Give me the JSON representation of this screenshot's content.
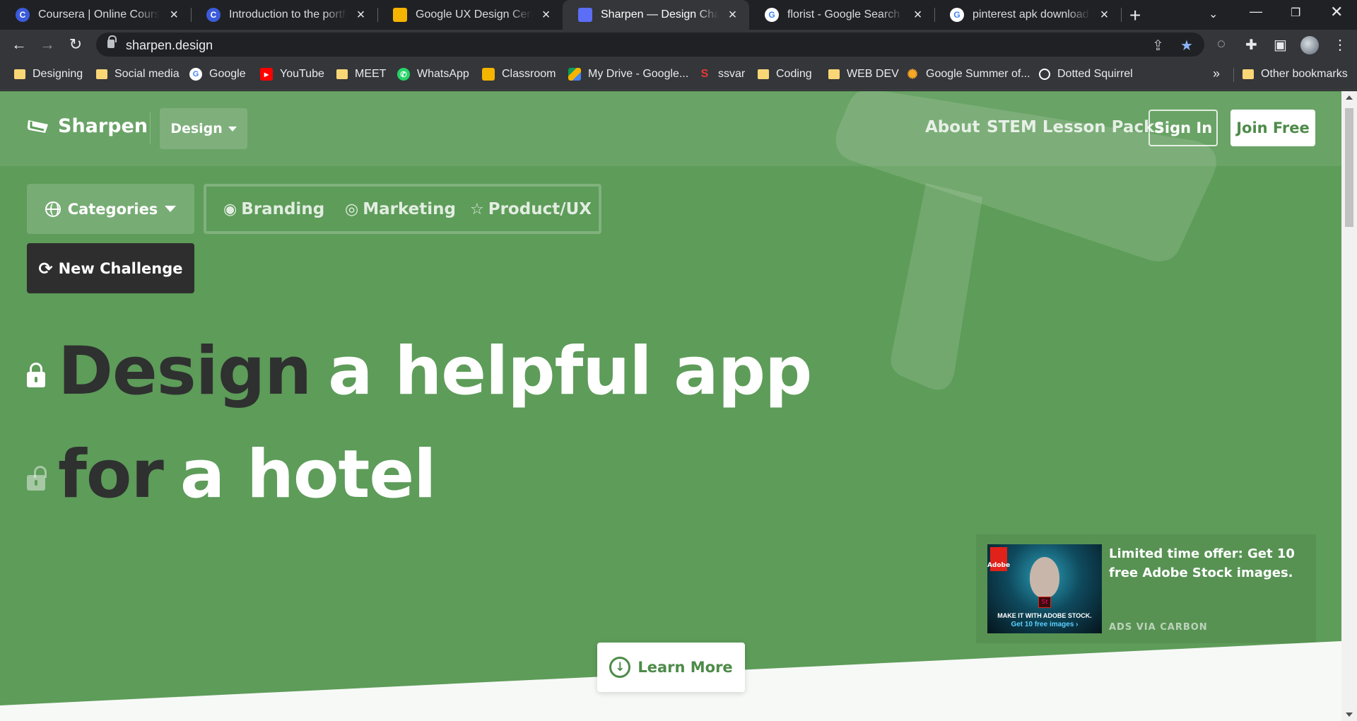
{
  "browser": {
    "tabs": [
      {
        "title": "Coursera | Online Courses & Credentials From Top Educators",
        "favicon": "coursera-icon",
        "favicon_color": "#3b5bdb"
      },
      {
        "title": "Introduction to the portfolio",
        "favicon": "coursera-icon",
        "favicon_color": "#3b5bdb"
      },
      {
        "title": "Google UX Design Certificate",
        "favicon": "slides-icon",
        "favicon_color": "#f4b400"
      },
      {
        "title": "Sharpen — Design Challenges",
        "favicon": "sharpen-icon",
        "favicon_color": "#5b6ef5"
      },
      {
        "title": "florist - Google Search",
        "favicon": "google-icon",
        "favicon_color": "#ffffff"
      },
      {
        "title": "pinterest apk download - Google Search",
        "favicon": "google-icon",
        "favicon_color": "#ffffff"
      }
    ],
    "active_tab_index": 3,
    "url": "sharpen.design",
    "bookmarks": [
      {
        "label": "Designing",
        "icon": "folder-icon"
      },
      {
        "label": "Social media",
        "icon": "folder-icon"
      },
      {
        "label": "Google",
        "icon": "google-icon"
      },
      {
        "label": "YouTube",
        "icon": "youtube-icon"
      },
      {
        "label": "MEET",
        "icon": "folder-icon"
      },
      {
        "label": "WhatsApp",
        "icon": "whatsapp-icon"
      },
      {
        "label": "Classroom",
        "icon": "classroom-icon"
      },
      {
        "label": "My Drive - Google...",
        "icon": "drive-icon"
      },
      {
        "label": "ssvar",
        "icon": "ssvar-icon"
      },
      {
        "label": "Coding",
        "icon": "folder-icon"
      },
      {
        "label": "WEB DEV",
        "icon": "folder-icon"
      },
      {
        "label": "Google Summer of...",
        "icon": "gsoc-icon"
      },
      {
        "label": "Dotted Squirrel",
        "icon": "circle-icon"
      }
    ],
    "more_bookmarks": "»",
    "other_bookmarks": "Other bookmarks"
  },
  "site": {
    "brand": "Sharpen",
    "section_dropdown": "Design",
    "nav": {
      "about": "About",
      "stem": "STEM Lesson Packs",
      "sign_in": "Sign In",
      "join": "Join Free"
    },
    "categories_button": "Categories",
    "categories": [
      {
        "label": "Branding",
        "icon": "eye-icon"
      },
      {
        "label": "Marketing",
        "icon": "target-icon"
      },
      {
        "label": "Product/UX",
        "icon": "star-icon"
      }
    ],
    "new_challenge": "New Challenge",
    "headline": {
      "line1_verb": "Design",
      "line1_object": "a helpful app",
      "line2_prep": "for",
      "line2_object": "a hotel"
    },
    "ad": {
      "text": "Limited time offer: Get 10 free Adobe Stock images.",
      "via": "ADS VIA CARBON",
      "image_caption_1": "MAKE IT WITH ADOBE STOCK.",
      "image_caption_2": "Get 10 free images ›",
      "image_logo": "Adobe",
      "image_badge": "St"
    },
    "learn_more": "Learn More"
  },
  "colors": {
    "page_green": "#5d9c59",
    "accent_green": "#4d8b49",
    "dark_text": "#2f3030",
    "chrome_dark": "#202124",
    "chrome_toolbar": "#35363a"
  }
}
